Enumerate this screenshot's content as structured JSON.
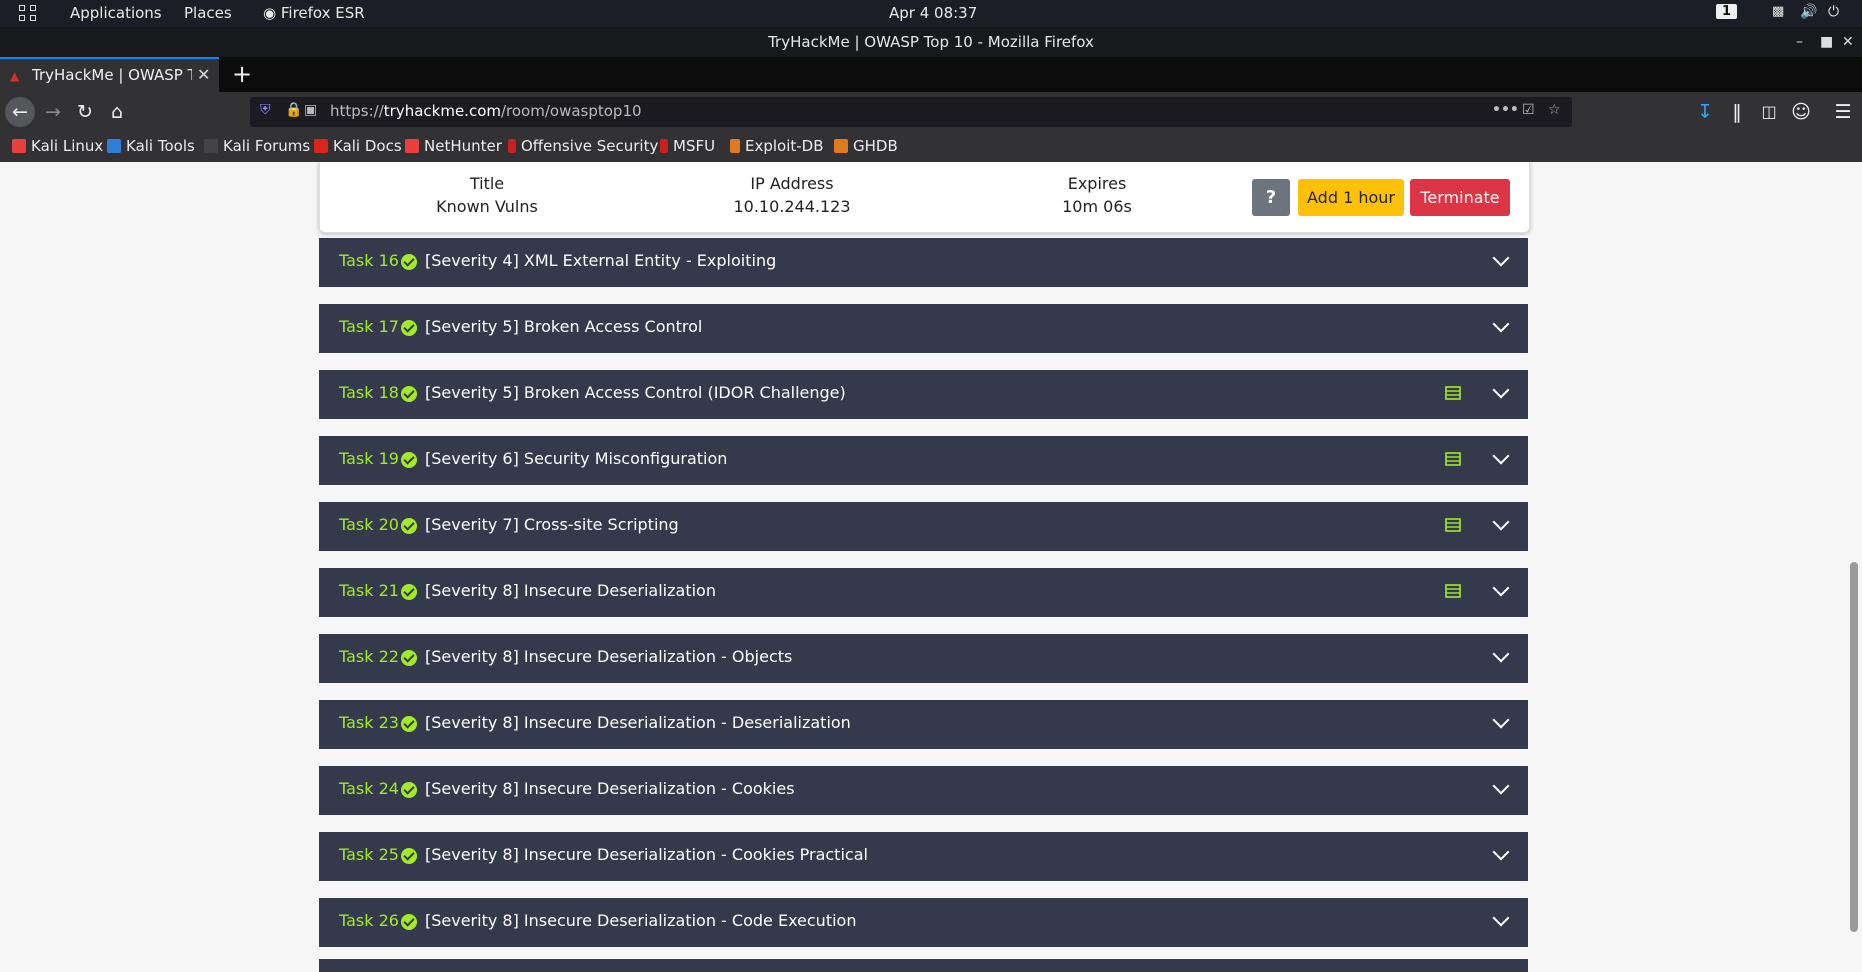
{
  "system_bar": {
    "applications": "Applications",
    "places": "Places",
    "browser_name": "Firefox ESR",
    "datetime": "Apr 4  08:37",
    "workspace": "1"
  },
  "window": {
    "title": "TryHackMe | OWASP Top 10 - Mozilla Firefox"
  },
  "tabs": [
    {
      "label": "TryHackMe | OWASP Top 10"
    }
  ],
  "nav": {
    "url_prefix": "https://",
    "url_domain": "tryhackme.com",
    "url_path": "/room/owasptop10",
    "page_actions": "•••"
  },
  "bookmarks": [
    {
      "label": "Kali Linux",
      "color": "#e8413d"
    },
    {
      "label": "Kali Tools",
      "color": "#2f7fd6"
    },
    {
      "label": "Kali Forums",
      "color": "#444444"
    },
    {
      "label": "Kali Docs",
      "color": "#d9261c"
    },
    {
      "label": "NetHunter",
      "color": "#e8413d"
    },
    {
      "label": "Offensive Security",
      "color": "#cc2020"
    },
    {
      "label": "MSFU",
      "color": "#cc2020"
    },
    {
      "label": "Exploit-DB",
      "color": "#e07a1f"
    },
    {
      "label": "GHDB",
      "color": "#e07a1f"
    }
  ],
  "machine": {
    "title_label": "Title",
    "title_value": "Known Vulns",
    "ip_label": "IP Address",
    "ip_value": "10.10.244.123",
    "expires_label": "Expires",
    "expires_value": "10m 06s",
    "help_label": "?",
    "add_hour_label": "Add 1 hour",
    "terminate_label": "Terminate"
  },
  "tasks": [
    {
      "number": "Task 16",
      "title": "[Severity 4] XML External Entity - Exploiting",
      "has_notes": false
    },
    {
      "number": "Task 17",
      "title": "[Severity 5] Broken Access Control",
      "has_notes": false
    },
    {
      "number": "Task 18",
      "title": "[Severity 5] Broken Access Control (IDOR Challenge)",
      "has_notes": true
    },
    {
      "number": "Task 19",
      "title": "[Severity 6] Security Misconfiguration",
      "has_notes": true
    },
    {
      "number": "Task 20",
      "title": "[Severity 7] Cross-site Scripting",
      "has_notes": true
    },
    {
      "number": "Task 21",
      "title": "[Severity 8] Insecure Deserialization",
      "has_notes": true
    },
    {
      "number": "Task 22",
      "title": "[Severity 8] Insecure Deserialization - Objects",
      "has_notes": false
    },
    {
      "number": "Task 23",
      "title": "[Severity 8] Insecure Deserialization - Deserialization",
      "has_notes": false
    },
    {
      "number": "Task 24",
      "title": "[Severity 8] Insecure Deserialization - Cookies",
      "has_notes": false
    },
    {
      "number": "Task 25",
      "title": "[Severity 8] Insecure Deserialization - Cookies Practical",
      "has_notes": false
    },
    {
      "number": "Task 26",
      "title": "[Severity 8] Insecure Deserialization - Code Execution",
      "has_notes": false
    }
  ],
  "colors": {
    "task_bg": "#343a4b",
    "task_accent": "#a3ea2a",
    "add_hour": "#ffc107",
    "terminate": "#dc3545"
  }
}
